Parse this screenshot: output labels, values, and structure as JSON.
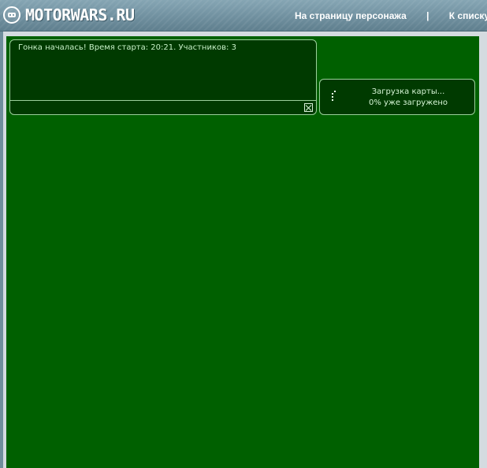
{
  "header": {
    "logo_text": "MOTORWARS.RU",
    "nav": [
      {
        "label": "На страницу персонажа"
      },
      {
        "separator": "|"
      },
      {
        "label": "К списку г"
      }
    ]
  },
  "chat": {
    "message": "Гонка началась! Время старта: 20:21. Участников: 3"
  },
  "loader": {
    "title": "Загрузка карты...",
    "progress_text": "0% уже загружено",
    "progress_percent": 0
  },
  "colors": {
    "game_background": "#006000",
    "panel_background": "#003a00",
    "panel_border": "#9ccf9c"
  }
}
